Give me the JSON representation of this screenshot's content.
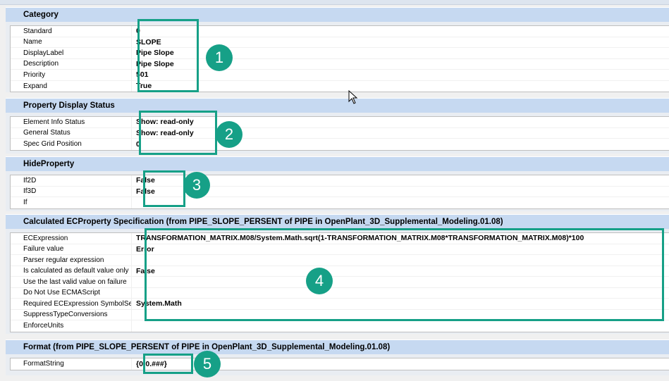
{
  "sections": [
    {
      "title": "Category",
      "rows": [
        {
          "name": "Standard",
          "value": "0"
        },
        {
          "name": "Name",
          "value": "SLOPE"
        },
        {
          "name": "DisplayLabel",
          "value": "Pipe Slope"
        },
        {
          "name": "Description",
          "value": "Pipe Slope"
        },
        {
          "name": "Priority",
          "value": "501"
        },
        {
          "name": "Expand",
          "value": "True"
        }
      ]
    },
    {
      "title": "Property Display Status",
      "rows": [
        {
          "name": "Element Info Status",
          "value": "Show: read-only"
        },
        {
          "name": "General Status",
          "value": "Show: read-only"
        },
        {
          "name": "Spec Grid Position",
          "value": "0"
        }
      ]
    },
    {
      "title": "HideProperty",
      "rows": [
        {
          "name": "If2D",
          "value": "False"
        },
        {
          "name": "If3D",
          "value": "False"
        },
        {
          "name": "If",
          "value": ""
        }
      ]
    },
    {
      "title": "Calculated ECProperty Specification (from PIPE_SLOPE_PERSENT of PIPE in OpenPlant_3D_Supplemental_Modeling.01.08)",
      "rows": [
        {
          "name": "ECExpression",
          "value": "TRANSFORMATION_MATRIX.M08/System.Math.sqrt(1-TRANSFORMATION_MATRIX.M08*TRANSFORMATION_MATRIX.M08)*100"
        },
        {
          "name": "Failure value",
          "value": "Error"
        },
        {
          "name": "Parser regular expression",
          "value": ""
        },
        {
          "name": "Is calculated as default value only",
          "value": "False"
        },
        {
          "name": "Use the last valid value on failure",
          "value": ""
        },
        {
          "name": "Do Not Use ECMAScript",
          "value": ""
        },
        {
          "name": "Required ECExpression SymbolSets",
          "value": "System.Math"
        },
        {
          "name": "SuppressTypeConversions",
          "value": ""
        },
        {
          "name": "EnforceUnits",
          "value": ""
        }
      ]
    },
    {
      "title": "Format (from PIPE_SLOPE_PERSENT of PIPE in OpenPlant_3D_Supplemental_Modeling.01.08)",
      "rows": [
        {
          "name": "FormatString",
          "value": "{0:0.###}"
        }
      ]
    }
  ],
  "annotations": [
    "1",
    "2",
    "3",
    "4",
    "5"
  ],
  "colors": {
    "accent": "#16a087",
    "header_bg": "#c6d9f1"
  }
}
